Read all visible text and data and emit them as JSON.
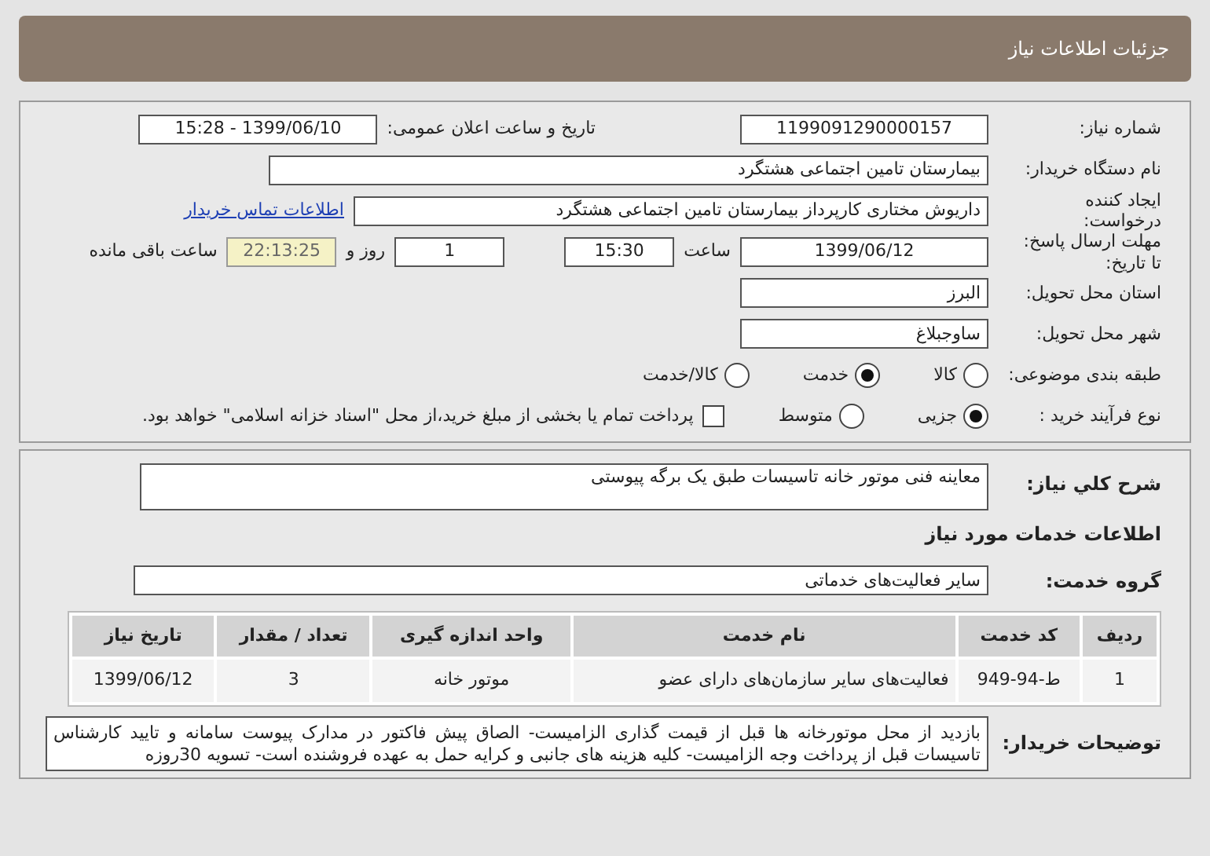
{
  "header": {
    "title": "جزئیات اطلاعات نیاز"
  },
  "need_number": {
    "label": "شماره نیاز:",
    "value": "1199091290000157"
  },
  "announce": {
    "label": "تاریخ و ساعت اعلان عمومی:",
    "value": "1399/06/10 - 15:28"
  },
  "buyer": {
    "label": "نام دستگاه خریدار:",
    "value": "بیمارستان تامین اجتماعی هشتگرد"
  },
  "creator": {
    "label_lines": [
      "ایجاد کننده",
      "درخواست:"
    ],
    "value": "داریوش مختاری کارپرداز بیمارستان تامین اجتماعی هشتگرد",
    "link": "اطلاعات تماس خریدار"
  },
  "deadline": {
    "label_lines": [
      "مهلت ارسال پاسخ:",
      "تا تاریخ:"
    ],
    "date": "1399/06/12",
    "time_label": "ساعت",
    "time": "15:30",
    "days": "1",
    "days_label": "روز و",
    "remaining": "22:13:25",
    "remaining_label": "ساعت باقی مانده"
  },
  "province": {
    "label": "استان محل تحویل:",
    "value": "البرز"
  },
  "city": {
    "label": "شهر محل تحویل:",
    "value": "ساوجبلاغ"
  },
  "category": {
    "label": "طبقه بندی موضوعی:",
    "options": [
      {
        "label": "کالا",
        "selected": false
      },
      {
        "label": "خدمت",
        "selected": true
      },
      {
        "label": "کالا/خدمت",
        "selected": false
      }
    ]
  },
  "process": {
    "label": "نوع فرآیند خرید :",
    "options": [
      {
        "label": "جزیی",
        "selected": true
      },
      {
        "label": "متوسط",
        "selected": false
      }
    ],
    "payment": {
      "checked": false,
      "text": "پرداخت تمام یا بخشی از مبلغ خرید،از محل \"اسناد خزانه اسلامی\" خواهد بود."
    }
  },
  "description": {
    "label": "شرح کلي نياز:",
    "value": "معاینه فنی موتور خانه تاسیسات طبق یک برگه پیوستی"
  },
  "services_heading": "اطلاعات خدمات مورد نیاز",
  "service_group": {
    "label": "گروه خدمت:",
    "value": "سایر فعالیت‌های خدماتی"
  },
  "table": {
    "columns": [
      "ردیف",
      "کد خدمت",
      "نام خدمت",
      "واحد اندازه گیری",
      "تعداد / مقدار",
      "تاریخ نیاز"
    ],
    "rows": [
      [
        "1",
        "ط-94-949",
        "فعالیت‌های سایر سازمان‌های دارای عضو",
        "موتور خانه",
        "3",
        "1399/06/12"
      ]
    ]
  },
  "buyer_notes": {
    "label": "توضیحات خریدار:",
    "value": "بازدید از محل موتورخانه ها قبل از قیمت گذاری الزامیست- الصاق پیش فاکتور در مدارک پیوست سامانه و تایید کارشناس تاسیسات قبل از پرداخت وجه الزامیست- کلیه هزینه های جانبی و کرایه حمل به عهده فروشنده است- تسویه 30روزه"
  }
}
